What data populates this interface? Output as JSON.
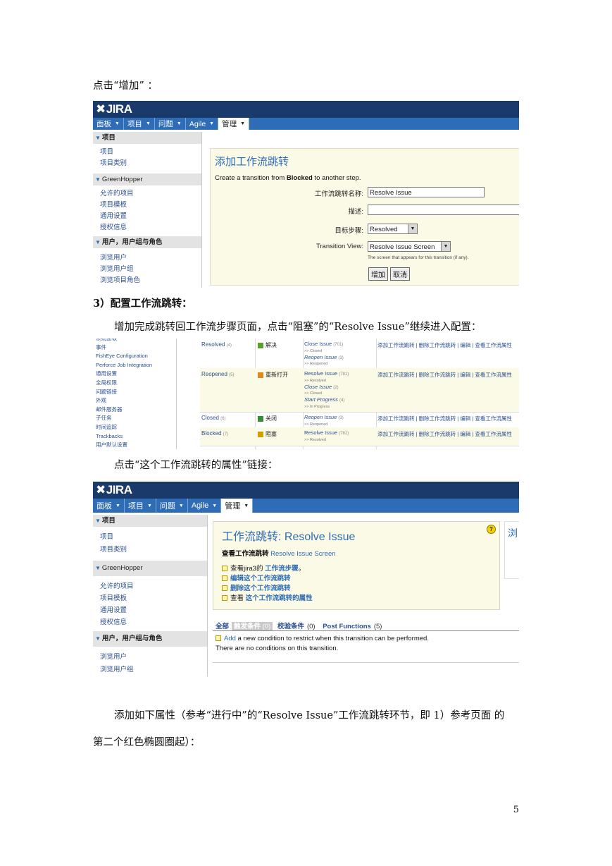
{
  "doc": {
    "para1": "点击“增加” ：",
    "heading3": "3）配置工作流跳转：",
    "para2": "增加完成跳转回工作流步骤页面，点击“阻塞”的“Resolve Issue”继续进入配置：",
    "para3": "点击“这个工作流跳转的属性”链接：",
    "para4_line1": "添加如下属性（参考“进行中”的“Resolve Issue”工作流跳转环节，即 1）参考页面 的",
    "para4_line2": "第二个红色椭圆圈起）：",
    "page_number": "5"
  },
  "jira": {
    "logo": "JIRA",
    "nav": [
      "面板",
      "项目",
      "问题",
      "Agile",
      "管理"
    ],
    "sidebar": {
      "project_header": "项目",
      "project_items": [
        "项目",
        "项目类别"
      ],
      "gh_header": "GreenHopper",
      "gh_items": [
        "允许的项目",
        "项目模板",
        "通用设置",
        "授权信息"
      ],
      "users_header": "用户，用户组与角色",
      "users_items": [
        "浏览用户",
        "浏览用户组",
        "浏览项目角色"
      ]
    }
  },
  "shot1": {
    "title": "添加工作流跳转",
    "desc_prefix": "Create a transition from ",
    "desc_bold": "Blocked",
    "desc_suffix": " to another step.",
    "name_label": "工作流跳转名称:",
    "name_value": "Resolve Issue",
    "desc_label": "描述:",
    "target_label": "目标步骤:",
    "target_value": "Resolved",
    "view_label": "Transition View:",
    "view_value": "Resolve Issue Screen",
    "view_hint": "The screen that appears for this transition (if any).",
    "add_button": "增加",
    "cancel_button": "取消"
  },
  "shot2": {
    "sidebar": [
      "系统面板",
      "事件",
      "FishEye Configuration",
      "Perforce Job Integration",
      "通用设置",
      "全局权限",
      "问题链接",
      "外观",
      "邮件服务器",
      "子任务",
      "时间追踪",
      "Trackbacks",
      "用户默认设置"
    ],
    "actions": "添加工作流跳转 | 删除工作流跳转 | 编辑 | 查看工作流属性",
    "rows": [
      {
        "step": "Resolved",
        "num": "(4)",
        "status": "解决",
        "color": "#5aa02c",
        "trans": [
          [
            "Close Issue",
            "(701)",
            ">> Closed"
          ],
          [
            "Reopen Issue",
            "(3)",
            ">> Reopened"
          ]
        ]
      },
      {
        "step": "Reopened",
        "num": "(5)",
        "status": "重新打开",
        "color": "#e08a1e",
        "trans": [
          [
            "Resolve Issue",
            "(781)",
            ">> Resolved"
          ],
          [
            "Close Issue",
            "(2)",
            ">> Closed"
          ],
          [
            "Start Progress",
            "(4)",
            ">> In Progress"
          ]
        ]
      },
      {
        "step": "Closed",
        "num": "(6)",
        "status": "关闭",
        "color": "#3a8a3a",
        "trans": [
          [
            "Reopen Issue",
            "(3)",
            ">> Reopened"
          ]
        ]
      },
      {
        "step": "Blocked",
        "num": "(7)",
        "status": "阻塞",
        "color": "#d0a000",
        "trans": [
          [
            "Resolve Issue",
            "(781)",
            ">> Resolved"
          ]
        ]
      }
    ]
  },
  "shot3": {
    "title": "工作流跳转: Resolve Issue",
    "view_label": "查看工作流跳转",
    "view_value": "Resolve Issue Screen",
    "help": "?",
    "right_fragment": "浏",
    "items": [
      {
        "pre": "查看jira3的 ",
        "link": "工作流步骤",
        "post": "。"
      },
      {
        "pre": "",
        "link": "编辑这个工作流跳转",
        "post": ""
      },
      {
        "pre": "",
        "link": "删除这个工作流跳转",
        "post": ""
      },
      {
        "pre": "查看 ",
        "link": "这个工作流跳转的属性",
        "post": ""
      }
    ],
    "tabs": {
      "all": "全部",
      "triggers": "触发条件",
      "triggers_n": "(0)",
      "validators": "校验条件",
      "validators_n": "(0)",
      "post": "Post Functions",
      "post_n": "(5)"
    },
    "add_link": "Add",
    "add_rest": " a new condition to restrict when this transition can be performed.",
    "no_cond": "There are no conditions on this transition."
  }
}
